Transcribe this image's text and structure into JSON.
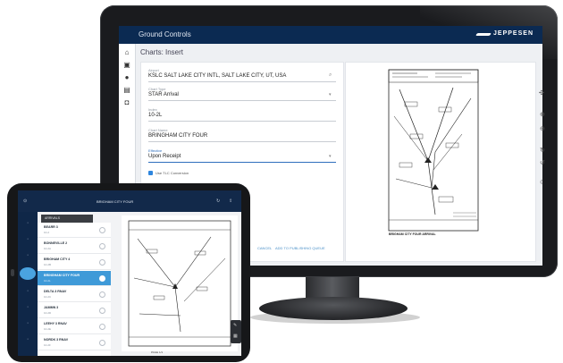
{
  "monitor": {
    "app_title": "Ground Controls",
    "brand": "JEPPESEN",
    "page_title": "Charts: Insert",
    "form": {
      "airport_label": "Airport",
      "airport_value": "KSLC SALT LAKE CITY INTL, SALT LAKE CITY, UT, USA",
      "chart_type_label": "Chart Type",
      "chart_type_value": "STAR Arrival",
      "index_label": "Index",
      "index_value": "10-2L",
      "chart_name_label": "Chart Name",
      "chart_name_value": "BRINGHAM CITY FOUR",
      "effective_label": "Effective",
      "effective_value": "Upon Receipt",
      "checkbox_label": "Use TLC Conversion",
      "checkbox_checked": true
    },
    "actions": {
      "cancel": "CANCEL",
      "add": "ADD TO PUBLISHING QUEUE"
    },
    "preview": {
      "footer_left": "BRIGHAM CITY FOUR ARRIVAL"
    }
  },
  "tablet": {
    "title": "BRIGHAM CITY FOUR",
    "list_header": "ARRIVALS",
    "items": [
      {
        "name": "BEARR 3",
        "sub": "10-2"
      },
      {
        "name": "BONNEVILLE 2",
        "sub": "10-2A"
      },
      {
        "name": "BRIGHAM CITY 4",
        "sub": "10-2B"
      },
      {
        "name": "BRINGHAM CITY FOUR",
        "sub": "10-2L",
        "selected": true
      },
      {
        "name": "DELTA 3 RNAV",
        "sub": "10-2C"
      },
      {
        "name": "JAMMN 3",
        "sub": "10-2D"
      },
      {
        "name": "LEEHY 3 RNAV",
        "sub": "10-2E"
      },
      {
        "name": "NORDK 3 RNAV",
        "sub": "10-2F"
      }
    ],
    "pages": "PAGE  1/1"
  },
  "colors": {
    "navy": "#0b2a52",
    "accent": "#3f9ad8"
  }
}
